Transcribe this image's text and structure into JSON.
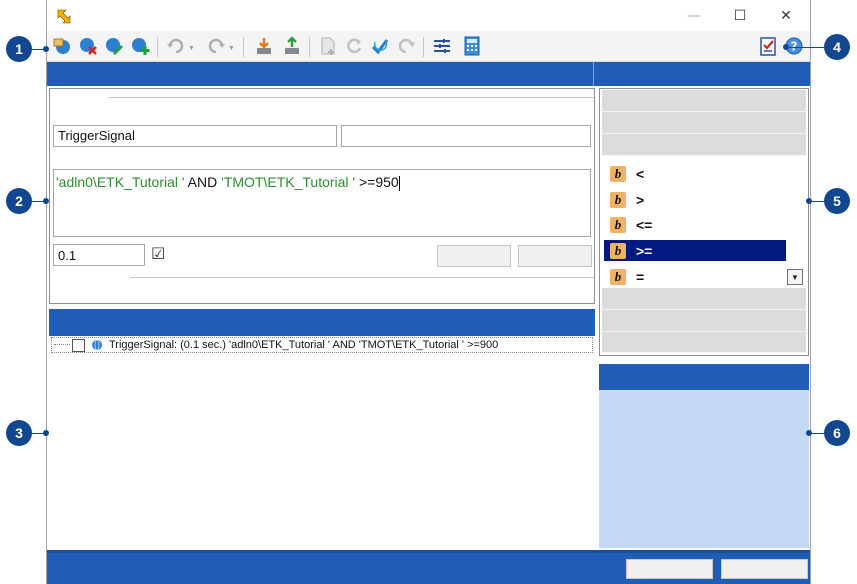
{
  "window": {
    "minimize_glyph": "—",
    "maximize_glyph": "☐",
    "close_glyph": "✕"
  },
  "form": {
    "name_value": "TriggerSignal",
    "secondary_value": "",
    "expr_part1": "'adln0\\ETK_Tutorial '",
    "expr_and": " AND ",
    "expr_part2": "'TMOT\\ETK_Tutorial '",
    "expr_op": " >=950",
    "interval_value": "0.1",
    "checkbox_glyph": "☑"
  },
  "list": {
    "rows": [
      {
        "text": "TriggerSignal: (0.1 sec.) 'adln0\\ETK_Tutorial ' AND 'TMOT\\ETK_Tutorial ' >=900"
      }
    ]
  },
  "operators": {
    "items": [
      {
        "badge": "b",
        "symbol": "<"
      },
      {
        "badge": "b",
        "symbol": ">"
      },
      {
        "badge": "b",
        "symbol": "<="
      },
      {
        "badge": "b",
        "symbol": ">="
      },
      {
        "badge": "b",
        "symbol": "="
      }
    ],
    "dropdown_glyph": "▼"
  },
  "callouts": [
    "1",
    "2",
    "3",
    "4",
    "5",
    "6"
  ],
  "colors": {
    "accent_blue": "#1f5db6",
    "callout_blue": "#12468f",
    "selection_navy": "#001a80",
    "info_panel": "#c5d8f5",
    "expr_green": "#2e8b2e"
  }
}
